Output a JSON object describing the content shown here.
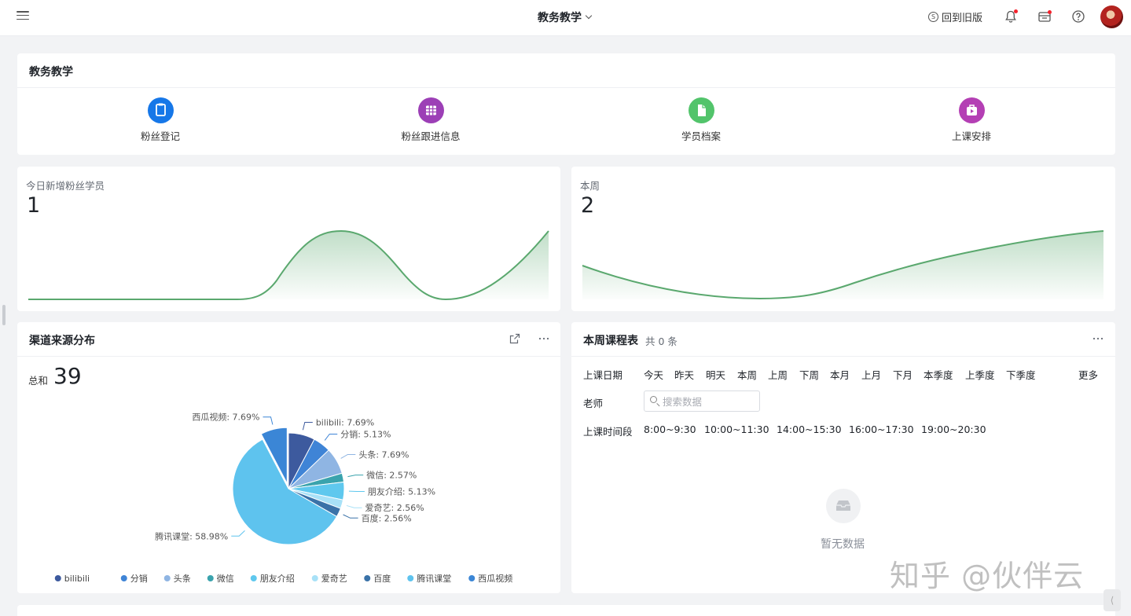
{
  "header": {
    "title": "教务教学",
    "old_version": "回到旧版",
    "old_version_icon": "s-circle-icon",
    "icons": [
      "bell-icon",
      "inbox-icon",
      "help-icon"
    ]
  },
  "quick": {
    "title": "教务教学",
    "items": [
      {
        "label": "粉丝登记",
        "icon": "clipboard-icon",
        "color": "#1677e8"
      },
      {
        "label": "粉丝跟进信息",
        "icon": "grid-icon",
        "color": "#9c3fb6"
      },
      {
        "label": "学员档案",
        "icon": "file-icon",
        "color": "#52c46b"
      },
      {
        "label": "上课安排",
        "icon": "video-bag-icon",
        "color": "#b43fb4"
      }
    ]
  },
  "stats": {
    "today": {
      "label": "今日新增粉丝学员",
      "value": "1"
    },
    "week": {
      "label": "本周",
      "value": "2"
    }
  },
  "channel": {
    "title": "渠道来源分布",
    "sum_label": "总和",
    "sum_value": "39"
  },
  "chart_data": {
    "type": "pie",
    "slices": [
      {
        "name": "bilibili",
        "label": "bilibili: 7.69%",
        "value": 7.69,
        "color": "#3d5a9e"
      },
      {
        "name": "分销",
        "label": "分销: 5.13%",
        "value": 5.13,
        "color": "#3f84d6"
      },
      {
        "name": "头条",
        "label": "头条: 7.69%",
        "value": 7.69,
        "color": "#8fb5e3"
      },
      {
        "name": "微信",
        "label": "微信: 2.57%",
        "value": 2.57,
        "color": "#3aa3ad"
      },
      {
        "name": "朋友介绍",
        "label": "朋友介绍: 5.13%",
        "value": 5.13,
        "color": "#5fc8ee"
      },
      {
        "name": "爱奇艺",
        "label": "爱奇艺: 2.56%",
        "value": 2.56,
        "color": "#a8e1f7"
      },
      {
        "name": "百度",
        "label": "百度: 2.56%",
        "value": 2.56,
        "color": "#3a72a8"
      },
      {
        "name": "腾讯课堂",
        "label": "腾讯课堂: 58.98%",
        "value": 58.98,
        "color": "#5ec3ee"
      },
      {
        "name": "西瓜视频",
        "label": "西瓜视频: 7.69%",
        "value": 7.69,
        "color": "#3b86d6"
      }
    ],
    "legend_position": "bottom"
  },
  "schedule": {
    "title": "本周课程表",
    "count": "共 0 条",
    "date_label": "上课日期",
    "date_options": [
      "今天",
      "昨天",
      "明天",
      "本周",
      "上周",
      "下周",
      "本月",
      "上月",
      "下月",
      "本季度",
      "上季度",
      "下季度"
    ],
    "more": "更多",
    "teacher_label": "老师",
    "search_placeholder": "搜索数据",
    "time_label": "上课时间段",
    "time_options": [
      "8:00~9:30",
      "10:00~11:30",
      "14:00~15:30",
      "16:00~17:30",
      "19:00~20:30"
    ],
    "empty_text": "暂无数据"
  },
  "watermark": "知乎 @伙伴云"
}
